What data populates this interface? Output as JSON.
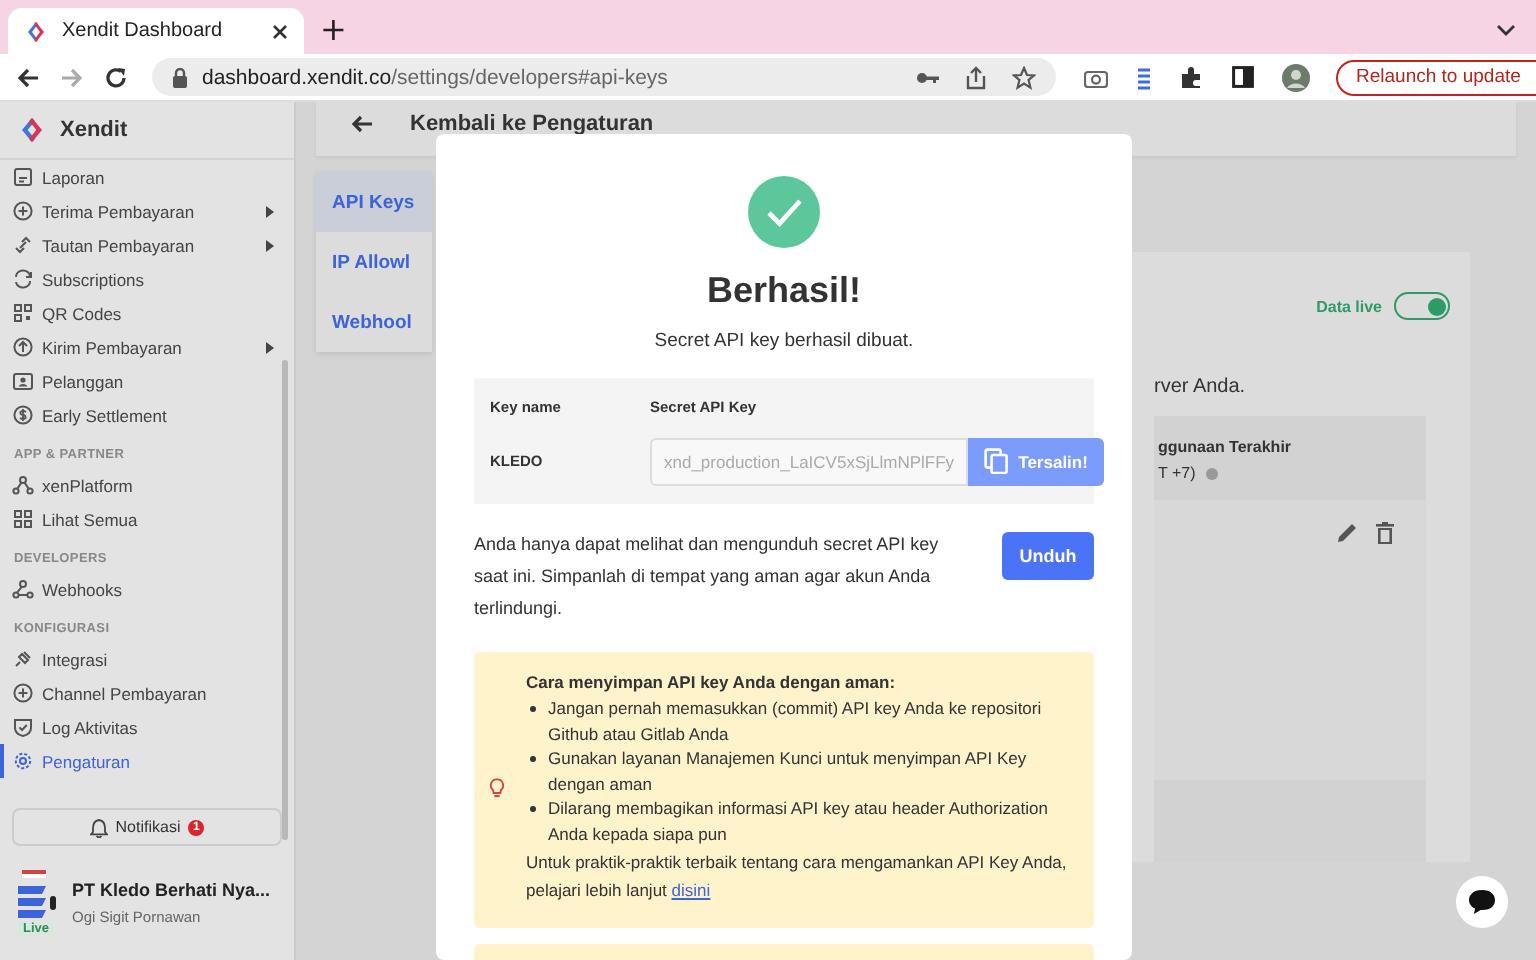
{
  "browser": {
    "tab_title": "Xendit Dashboard",
    "new_tab": "+",
    "url_host": "dashboard.xendit.co",
    "url_path": "/settings/developers#api-keys",
    "relaunch": "Relaunch to update"
  },
  "sidebar": {
    "brand": "Xendit",
    "items": [
      {
        "kind": "item",
        "label": "Laporan",
        "caret": false,
        "selected": false
      },
      {
        "kind": "item",
        "label": "Terima Pembayaran",
        "caret": true,
        "selected": false
      },
      {
        "kind": "item",
        "label": "Tautan Pembayaran",
        "caret": true,
        "selected": false
      },
      {
        "kind": "item",
        "label": "Subscriptions",
        "caret": false,
        "selected": false
      },
      {
        "kind": "item",
        "label": "QR Codes",
        "caret": false,
        "selected": false
      },
      {
        "kind": "item",
        "label": "Kirim Pembayaran",
        "caret": true,
        "selected": false
      },
      {
        "kind": "item",
        "label": "Pelanggan",
        "caret": false,
        "selected": false
      },
      {
        "kind": "item",
        "label": "Early Settlement",
        "caret": false,
        "selected": false
      },
      {
        "kind": "section",
        "label": "APP & PARTNER"
      },
      {
        "kind": "item",
        "label": "xenPlatform",
        "caret": false,
        "selected": false
      },
      {
        "kind": "item",
        "label": "Lihat Semua",
        "caret": false,
        "selected": false
      },
      {
        "kind": "section",
        "label": "DEVELOPERS"
      },
      {
        "kind": "item",
        "label": "Webhooks",
        "caret": false,
        "selected": false
      },
      {
        "kind": "section",
        "label": "KONFIGURASI"
      },
      {
        "kind": "item",
        "label": "Integrasi",
        "caret": false,
        "selected": false
      },
      {
        "kind": "item",
        "label": "Channel Pembayaran",
        "caret": false,
        "selected": false
      },
      {
        "kind": "item",
        "label": "Log Aktivitas",
        "caret": false,
        "selected": false
      },
      {
        "kind": "item",
        "label": "Pengaturan",
        "caret": false,
        "selected": true
      }
    ],
    "notifications": {
      "label": "Notifikasi",
      "count": "1"
    },
    "account": {
      "name": "PT Kledo Berhati Nya...",
      "user": "Ogi Sigit Pornawan",
      "badge": "Live"
    }
  },
  "main": {
    "back_title": "Kembali ke Pengaturan",
    "side_tabs": [
      {
        "label": "API Keys",
        "selected": true
      },
      {
        "label": "IP Allowl",
        "selected": false
      },
      {
        "label": "Webhool",
        "selected": false
      }
    ],
    "live_toggle": {
      "label": "Data live",
      "on": true
    },
    "description": "rver Anda.",
    "table": {
      "header_1": "ggunaan Terakhir",
      "header_2": "T +7)"
    }
  },
  "modal": {
    "title": "Berhasil!",
    "subtitle": "Secret API key berhasil dibuat.",
    "key_table": {
      "columns": [
        "Key name",
        "Secret API Key"
      ],
      "key_name": "KLEDO",
      "secret_value": "xnd_production_LaICV5xSjLlmNPlFFy",
      "copy_button": "Tersalin!"
    },
    "notice": "Anda hanya dapat melihat dan mengunduh secret API key saat ini. Simpanlah di tempat yang aman agar akun Anda terlindungi.",
    "download_button": "Unduh",
    "tips": {
      "heading": "Cara menyimpan API key Anda dengan aman:",
      "bullets": [
        "Jangan pernah memasukkan (commit) API key Anda ke repositori Github atau Gitlab Anda",
        "Gunakan layanan Manajemen Kunci untuk menyimpan API Key dengan aman",
        "Dilarang membagikan informasi API key atau header Authorization Anda kepada siapa pun"
      ],
      "footer": "Untuk praktik-praktik terbaik tentang cara mengamankan API Key Anda, pelajari lebih lanjut",
      "link": "disini"
    }
  }
}
